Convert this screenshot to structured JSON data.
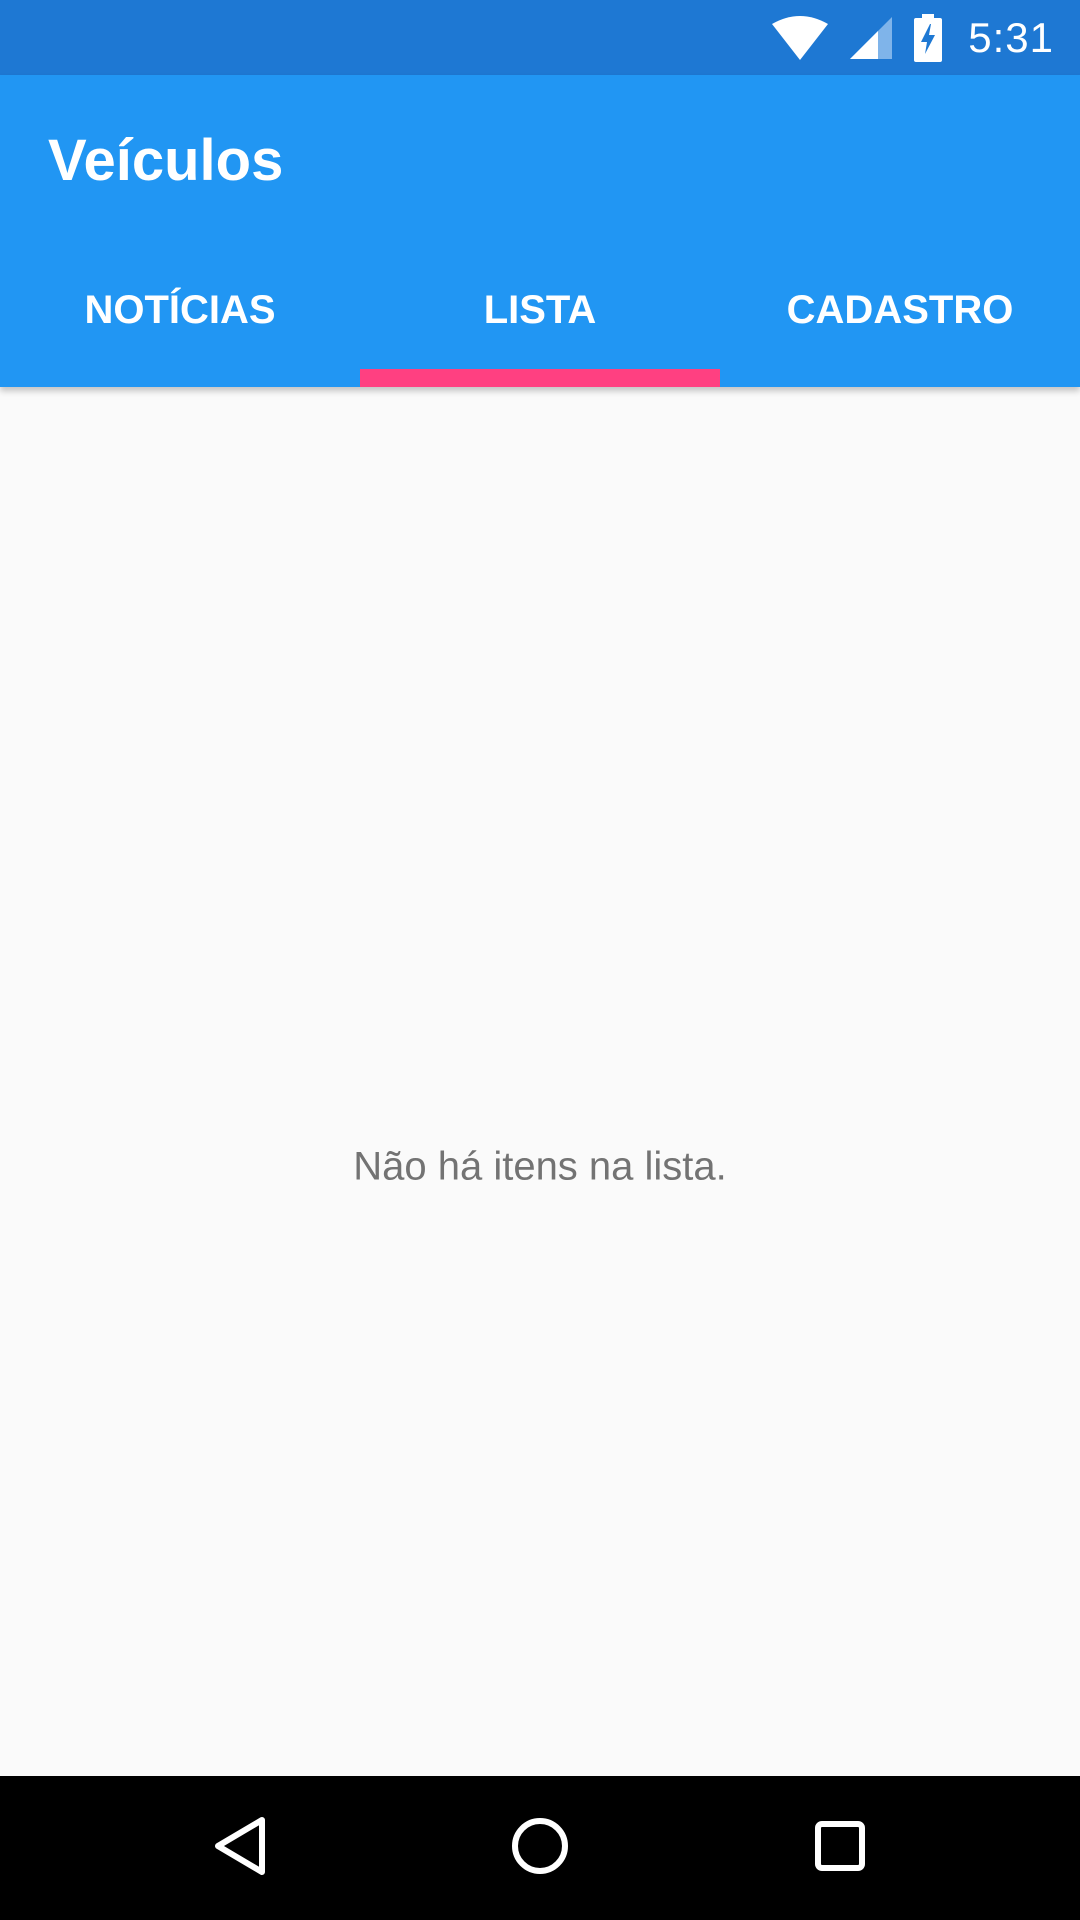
{
  "status_bar": {
    "time": "5:31",
    "icons": [
      "wifi-icon",
      "cellular-signal-icon",
      "battery-charging-icon"
    ]
  },
  "app_bar": {
    "title": "Veículos"
  },
  "tabs": [
    {
      "label": "NOTÍCIAS",
      "selected": false
    },
    {
      "label": "LISTA",
      "selected": true
    },
    {
      "label": "CADASTRO",
      "selected": false
    }
  ],
  "content": {
    "empty_message": "Não há itens na lista."
  },
  "nav_bar": {
    "buttons": [
      "back-icon",
      "home-icon",
      "recents-icon"
    ]
  },
  "colors": {
    "status_bar": "#1e78d3",
    "app_bar": "#2196f3",
    "tab_indicator": "#ff4081",
    "background": "#fafafa",
    "empty_text": "#737373",
    "nav_bar": "#000000"
  }
}
